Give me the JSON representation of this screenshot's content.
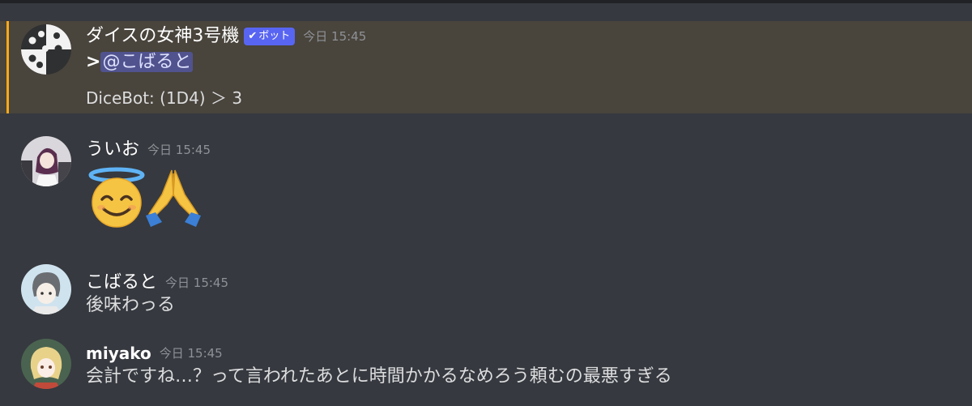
{
  "messages": [
    {
      "username": "ダイスの女神3号機",
      "bot_tag": "ボット",
      "bot_check": "✔",
      "timestamp": "今日 15:45",
      "reply_prefix": ">",
      "mention": "@こばると",
      "dice_result": "DiceBot: (1D4) ＞ 3",
      "avatar_icon": "dice-icon"
    },
    {
      "username": "ういお",
      "timestamp": "今日 15:45",
      "emojis": [
        "smiling-face-with-halo-emoji",
        "folded-hands-emoji"
      ]
    },
    {
      "username": "こばると",
      "timestamp": "今日 15:45",
      "content": "後味わっる"
    },
    {
      "username": "miyako",
      "timestamp": "今日 15:45",
      "content": "会計ですね…？って言われたあとに時間かかるなめろう頼むの最悪すぎる"
    }
  ],
  "colors": {
    "background": "#36393f",
    "highlight": "#49443c",
    "highlight_bar": "#faa81a",
    "bot_tag": "#5865f2",
    "timestamp": "#8e9297"
  }
}
